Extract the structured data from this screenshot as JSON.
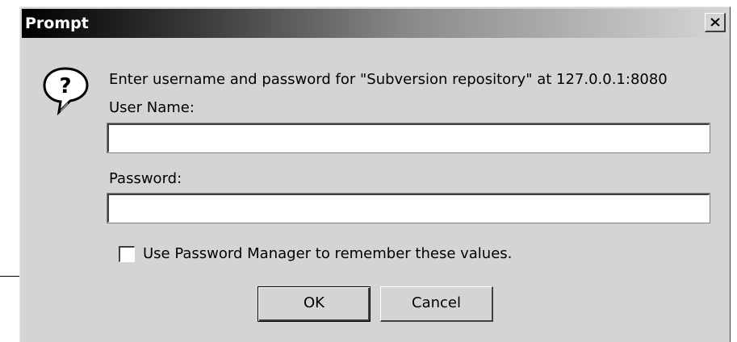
{
  "window": {
    "title": "Prompt",
    "close_glyph": "x"
  },
  "dialog": {
    "icon": "question-icon",
    "message": "Enter username and password for \"Subversion repository\" at 127.0.0.1:8080",
    "user_label": "User Name:",
    "user_value": "",
    "password_label": "Password:",
    "password_value": "",
    "remember_label": "Use Password Manager to remember these values.",
    "remember_checked": false
  },
  "buttons": {
    "ok_label": "OK",
    "cancel_label": "Cancel"
  },
  "colors": {
    "face": "#d4d4d4",
    "titlebar_start": "#000000",
    "titlebar_end": "#d6d6d6"
  }
}
